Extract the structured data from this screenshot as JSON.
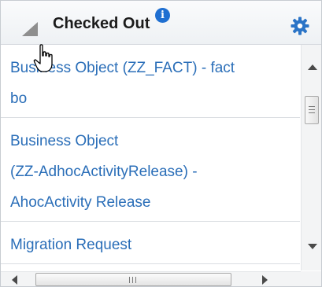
{
  "panel": {
    "title": "Checked Out",
    "info_icon_glyph": "i",
    "accent_color": "#1f6fd1",
    "link_color": "#2a6eb8"
  },
  "items": [
    {
      "lines": [
        "Business Object (ZZ_FACT) - fact",
        "bo"
      ]
    },
    {
      "lines": [
        "Business Object",
        "(ZZ-AdhocActivityRelease) -",
        "AhocActivity Release"
      ]
    },
    {
      "lines": [
        "Migration Request"
      ]
    }
  ],
  "icons": {
    "collapse": "triangle-collapse-icon",
    "info": "info-icon",
    "settings": "gear-icon",
    "cursor": "hand-pointer-icon"
  }
}
